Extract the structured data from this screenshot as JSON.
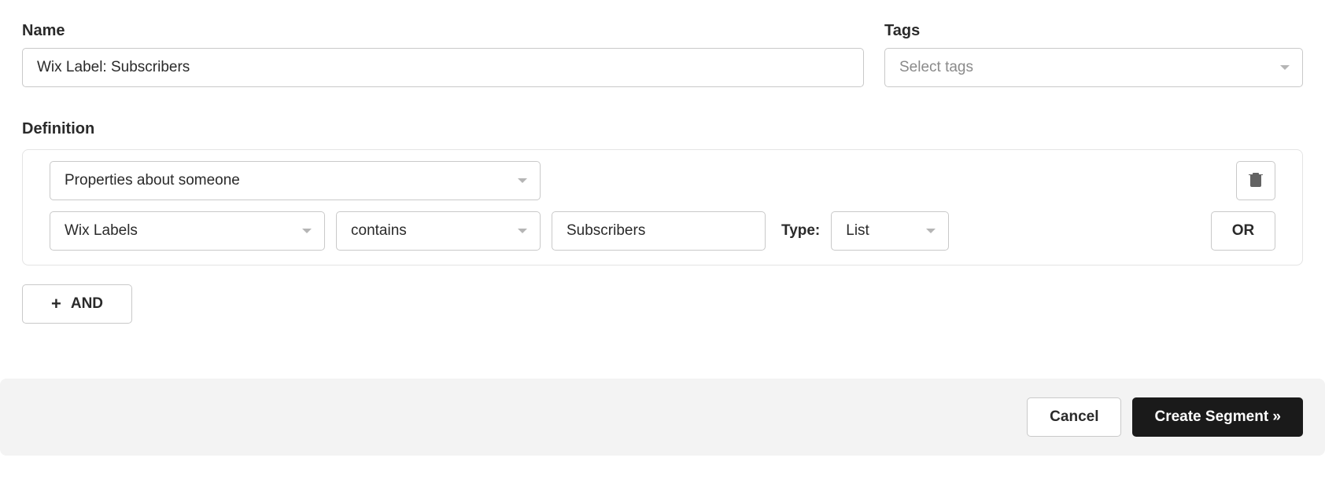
{
  "name": {
    "label": "Name",
    "value": "Wix Label: Subscribers"
  },
  "tags": {
    "label": "Tags",
    "placeholder": "Select tags"
  },
  "definition": {
    "label": "Definition",
    "condition_type": "Properties about someone",
    "property": "Wix Labels",
    "operator": "contains",
    "value": "Subscribers",
    "type_label": "Type:",
    "value_type": "List",
    "or_label": "OR",
    "and_label": "AND"
  },
  "footer": {
    "cancel_label": "Cancel",
    "create_label": "Create Segment »"
  }
}
